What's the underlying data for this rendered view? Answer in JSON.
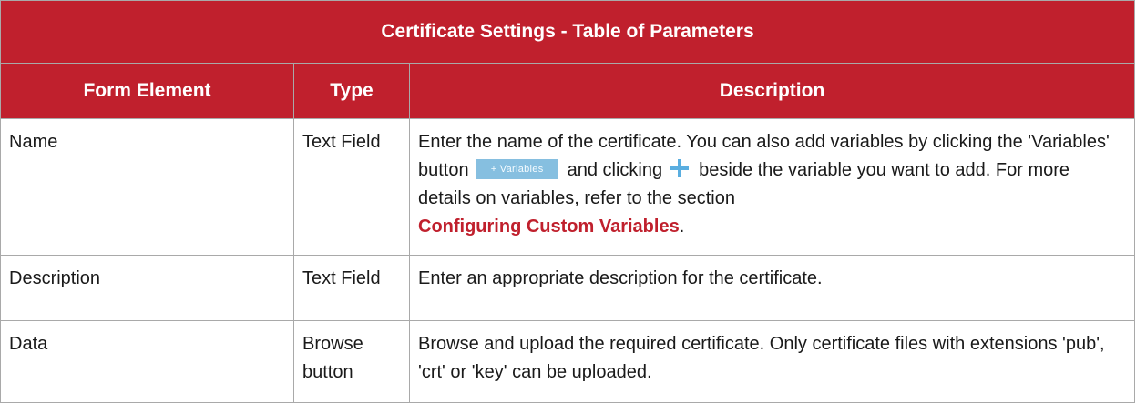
{
  "table": {
    "title": "Certificate Settings - Table of Parameters",
    "headers": [
      "Form Element",
      "Type",
      "Description"
    ],
    "rows": [
      {
        "element": "Name",
        "type": "Text Field",
        "desc_part1": "Enter the name of the certificate. You can also add variables by clicking the 'Variables' button",
        "variables_button": "+ Variables",
        "desc_part2": "and clicking",
        "plus_icon": "plus-icon",
        "desc_part3": "beside the variable you want to add. For more details on variables, refer to the section",
        "link_text": "Configuring Custom Variables",
        "desc_end": "."
      },
      {
        "element": "Description",
        "type": "Text Field",
        "description": "Enter an appropriate description for the certificate."
      },
      {
        "element": "Data",
        "type": "Browse button",
        "description": "Browse and upload the required certificate. Only certificate files with extensions 'pub', 'crt' or 'key' can be uploaded."
      }
    ]
  },
  "colors": {
    "header_bg": "#c0202d",
    "header_text": "#ffffff",
    "link": "#c0202d",
    "variables_button_bg": "#86bfe0",
    "plus_icon": "#5aaee0",
    "border": "#a9a9a9"
  }
}
